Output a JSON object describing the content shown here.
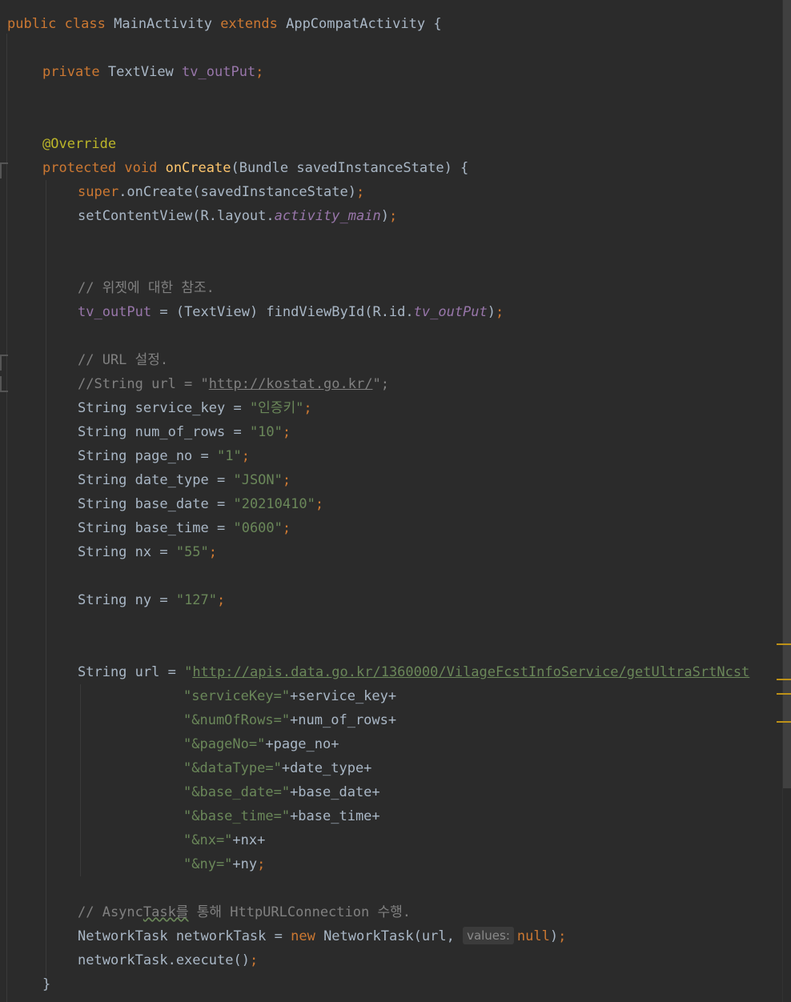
{
  "code": {
    "class_decl": {
      "kw1": "public",
      "kw2": "class",
      "name": "MainActivity",
      "kw3": "extends",
      "parent": "AppCompatActivity",
      "brace": " {"
    },
    "field_decl": {
      "kw": "private",
      "type": "TextView",
      "name": "tv_outPut",
      "semi": ";"
    },
    "annotation": "@Override",
    "method_decl": {
      "kw1": "protected",
      "kw2": "void",
      "name": "onCreate",
      "params": "(Bundle savedInstanceState) {"
    },
    "super_call": {
      "kw": "super",
      "rest": ".onCreate(savedInstanceState)",
      "semi": ";"
    },
    "set_content": {
      "pre": "setContentView(R.layout.",
      "field": "activity_main",
      "post": ")",
      "semi": ";"
    },
    "comment_widget": "// 위젯에 대한 참조.",
    "find_view": {
      "target": "tv_outPut",
      "mid": " = (TextView) findViewById(R.id.",
      "field": "tv_outPut",
      "post": ")",
      "semi": ";"
    },
    "comment_url": "// URL 설정.",
    "comment_string_url": {
      "pre": "//String url = \"",
      "link": "http://kostat.go.kr/",
      "post": "\";"
    },
    "string_vars": [
      {
        "decl": "String service_key = ",
        "value": "\"인증키\"",
        "semi": ";"
      },
      {
        "decl": "String num_of_rows = ",
        "value": "\"10\"",
        "semi": ";"
      },
      {
        "decl": "String page_no = ",
        "value": "\"1\"",
        "semi": ";"
      },
      {
        "decl": "String date_type = ",
        "value": "\"JSON\"",
        "semi": ";"
      },
      {
        "decl": "String base_date = ",
        "value": "\"20210410\"",
        "semi": ";"
      },
      {
        "decl": "String base_time = ",
        "value": "\"0600\"",
        "semi": ";"
      },
      {
        "decl": "String nx = ",
        "value": "\"55\"",
        "semi": ";"
      }
    ],
    "ny_var": {
      "decl": "String ny = ",
      "value": "\"127\"",
      "semi": ";"
    },
    "url_line": {
      "decl": "String url = ",
      "quote": "\"",
      "link": "http://apis.data.go.kr/1360000/VilageFcstInfoService/getUltraSrtNcst"
    },
    "url_params": [
      {
        "str": "\"serviceKey=\"",
        "rest": "+service_key+"
      },
      {
        "str": "\"&numOfRows=\"",
        "rest": "+num_of_rows+"
      },
      {
        "str": "\"&pageNo=\"",
        "rest": "+page_no+"
      },
      {
        "str": "\"&dataType=\"",
        "rest": "+date_type+"
      },
      {
        "str": "\"&base_date=\"",
        "rest": "+base_date+"
      },
      {
        "str": "\"&base_time=\"",
        "rest": "+base_time+"
      },
      {
        "str": "\"&nx=\"",
        "rest": "+nx+"
      },
      {
        "str": "\"&ny=\"",
        "rest": "+ny",
        "semi": ";"
      }
    ],
    "comment_async": {
      "pre": "// Async",
      "squig": "Task를",
      "post": " 통해 HttpURLConnection 수행."
    },
    "network_task": {
      "decl": "NetworkTask networkTask = ",
      "kw": "new",
      "call": " NetworkTask(url, ",
      "hint": "values:",
      "kw2": "null",
      "post": ")",
      "semi": ";"
    },
    "execute": {
      "call": "networkTask.execute()",
      "semi": ";"
    },
    "close_brace": "}"
  },
  "colors": {
    "background": "#2b2b2b",
    "keyword": "#cc7832",
    "string": "#6a8759",
    "comment": "#808080",
    "field": "#9876aa",
    "method": "#ffc66d",
    "annotation": "#bbb529",
    "text": "#a9b7c6"
  }
}
